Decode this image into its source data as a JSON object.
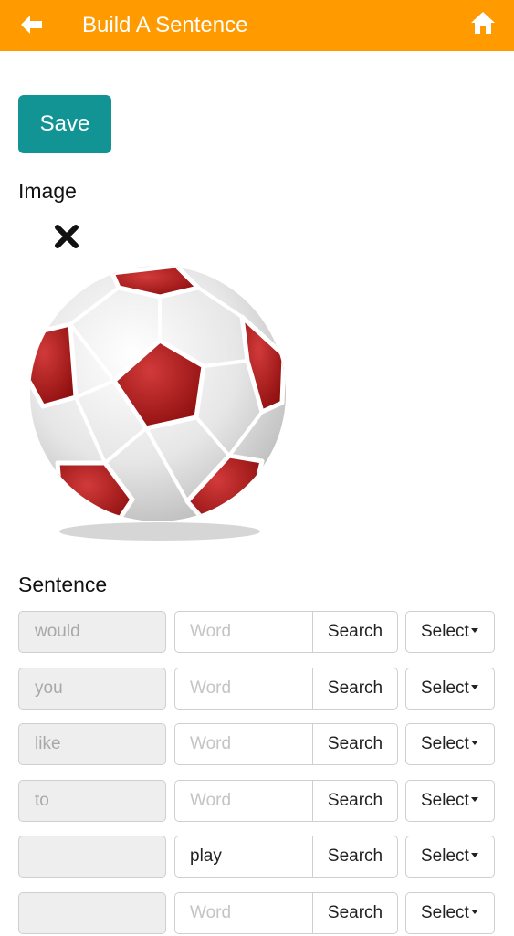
{
  "header": {
    "title": "Build A Sentence",
    "back_icon": "arrow-left-icon",
    "home_icon": "home-icon",
    "background_color": "#ff9a00"
  },
  "save_button": {
    "label": "Save",
    "color": "#139494"
  },
  "image_section": {
    "label": "Image",
    "remove_icon": "close-x-icon",
    "image_subject": "soccer-ball"
  },
  "sentence_section": {
    "label": "Sentence",
    "rows": [
      {
        "given": "would",
        "word_value": "",
        "word_placeholder": "Word",
        "search_label": "Search",
        "select_label": "Select"
      },
      {
        "given": "you",
        "word_value": "",
        "word_placeholder": "Word",
        "search_label": "Search",
        "select_label": "Select"
      },
      {
        "given": "like",
        "word_value": "",
        "word_placeholder": "Word",
        "search_label": "Search",
        "select_label": "Select"
      },
      {
        "given": "to",
        "word_value": "",
        "word_placeholder": "Word",
        "search_label": "Search",
        "select_label": "Select"
      },
      {
        "given": "",
        "word_value": "play",
        "word_placeholder": "Word",
        "search_label": "Search",
        "select_label": "Select"
      },
      {
        "given": "",
        "word_value": "",
        "word_placeholder": "Word",
        "search_label": "Search",
        "select_label": "Select"
      }
    ]
  }
}
